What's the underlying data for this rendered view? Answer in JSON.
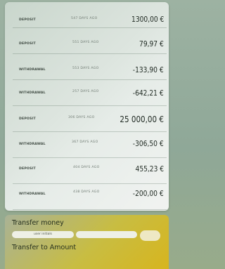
{
  "transactions": [
    {
      "type": "DEPOSIT",
      "date": "547 DAYS AGO",
      "amount": "1300,00 €"
    },
    {
      "type": "DEPOSIT",
      "date": "551 DAYS AGO",
      "amount": "79,97 €"
    },
    {
      "type": "WITHDRAWAL",
      "date": "553 DAYS AGO",
      "amount": "-133,90 €"
    },
    {
      "type": "WITHDRAWAL",
      "date": "257 DAYS AGO",
      "amount": "-642,21 €"
    },
    {
      "type": "DEPOSIT",
      "date": "306 DAYS AGO",
      "amount": "25 000,00 €"
    },
    {
      "type": "WITHDRAWAL",
      "date": "367 DAYS AGO",
      "amount": "-306,50 €"
    },
    {
      "type": "DEPOSIT",
      "date": "404 DAYS AGO",
      "amount": "455,23 €"
    },
    {
      "type": "WITHDRAWAL",
      "date": "438 DAYS AGO",
      "amount": "-200,00 €"
    }
  ],
  "transfer": {
    "title": "Transfer money",
    "initials_placeholder": "user initials",
    "subtitle": "Transfer to Amount"
  },
  "colors": {
    "card_bg": "#e6ece8",
    "transfer_gradient_start": "#a9b296",
    "transfer_gradient_end": "#d7b51e"
  }
}
